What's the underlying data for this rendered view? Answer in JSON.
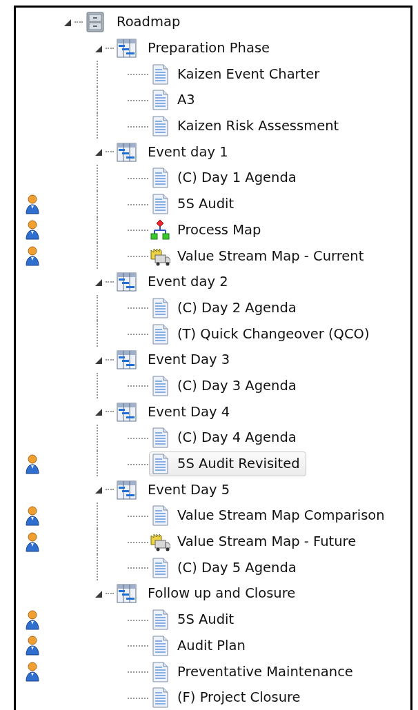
{
  "tree": [
    {
      "label": "Roadmap",
      "kind": "cabinet",
      "expanded": true,
      "selected": false,
      "children": [
        {
          "label": "Preparation Phase",
          "kind": "gantt",
          "expanded": true,
          "selected": false,
          "children": [
            {
              "label": "Kaizen Event Charter",
              "kind": "document",
              "selected": false,
              "assigned": false
            },
            {
              "label": "A3",
              "kind": "document",
              "selected": false,
              "assigned": false
            },
            {
              "label": "Kaizen Risk Assessment",
              "kind": "document",
              "selected": false,
              "assigned": false
            }
          ]
        },
        {
          "label": "Event day 1",
          "kind": "gantt",
          "expanded": true,
          "selected": false,
          "children": [
            {
              "label": "(C) Day 1 Agenda",
              "kind": "document",
              "selected": false,
              "assigned": false
            },
            {
              "label": "5S Audit",
              "kind": "document",
              "selected": false,
              "assigned": true
            },
            {
              "label": "Process Map",
              "kind": "flowchart",
              "selected": false,
              "assigned": true
            },
            {
              "label": "Value Stream Map - Current",
              "kind": "factory",
              "selected": false,
              "assigned": true
            }
          ]
        },
        {
          "label": "Event day 2",
          "kind": "gantt",
          "expanded": true,
          "selected": false,
          "children": [
            {
              "label": "(C) Day 2 Agenda",
              "kind": "document",
              "selected": false,
              "assigned": false
            },
            {
              "label": "(T) Quick Changeover (QCO)",
              "kind": "document",
              "selected": false,
              "assigned": false
            }
          ]
        },
        {
          "label": "Event Day 3",
          "kind": "gantt",
          "expanded": true,
          "selected": false,
          "children": [
            {
              "label": "(C) Day 3 Agenda",
              "kind": "document",
              "selected": false,
              "assigned": false
            }
          ]
        },
        {
          "label": "Event Day 4",
          "kind": "gantt",
          "expanded": true,
          "selected": false,
          "children": [
            {
              "label": "(C) Day 4 Agenda",
              "kind": "document",
              "selected": false,
              "assigned": false
            },
            {
              "label": "5S Audit Revisited",
              "kind": "document",
              "selected": true,
              "assigned": true
            }
          ]
        },
        {
          "label": "Event Day 5",
          "kind": "gantt",
          "expanded": true,
          "selected": false,
          "children": [
            {
              "label": "Value Stream Map Comparison",
              "kind": "document",
              "selected": false,
              "assigned": true
            },
            {
              "label": "Value Stream Map - Future",
              "kind": "factory",
              "selected": false,
              "assigned": true
            },
            {
              "label": "(C) Day 5 Agenda",
              "kind": "document",
              "selected": false,
              "assigned": false
            }
          ]
        },
        {
          "label": "Follow up and Closure",
          "kind": "gantt",
          "expanded": true,
          "selected": false,
          "children": [
            {
              "label": "5S Audit",
              "kind": "document",
              "selected": false,
              "assigned": true
            },
            {
              "label": "Audit Plan",
              "kind": "document",
              "selected": false,
              "assigned": true
            },
            {
              "label": "Preventative Maintenance",
              "kind": "document",
              "selected": false,
              "assigned": true
            },
            {
              "label": "(F) Project Closure",
              "kind": "document",
              "selected": false,
              "assigned": false
            }
          ]
        }
      ]
    }
  ]
}
